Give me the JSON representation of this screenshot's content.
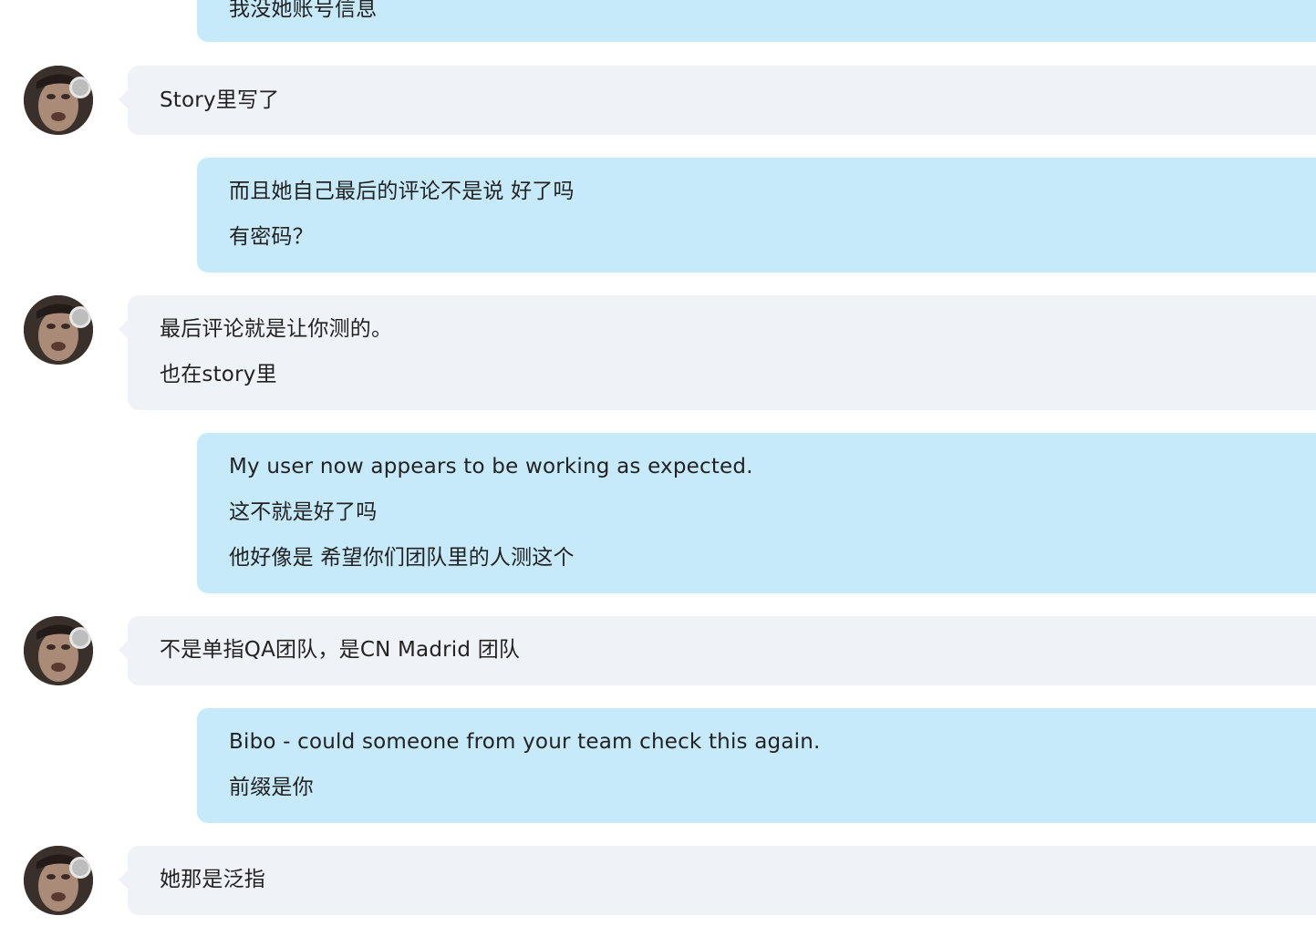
{
  "conversation": {
    "messages": [
      {
        "sender": "me",
        "lines": [
          "我没她账号信息"
        ]
      },
      {
        "sender": "other",
        "lines": [
          "Story里写了"
        ]
      },
      {
        "sender": "me",
        "lines": [
          "而且她自己最后的评论不是说 好了吗",
          "有密码？"
        ]
      },
      {
        "sender": "other",
        "lines": [
          "最后评论就是让你测的。",
          "也在story里"
        ]
      },
      {
        "sender": "me",
        "lines": [
          "My user now appears to be working as expected.",
          "这不就是好了吗",
          "他好像是 希望你们团队里的人测这个"
        ]
      },
      {
        "sender": "other",
        "lines": [
          "不是单指QA团队，是CN Madrid 团队"
        ]
      },
      {
        "sender": "me",
        "lines": [
          "Bibo - could someone from your team check this again.",
          "前缀是你"
        ]
      },
      {
        "sender": "other",
        "lines": [
          "她那是泛指"
        ]
      }
    ]
  },
  "colors": {
    "my_bubble": "#c7eafa",
    "their_bubble": "#eff2f7",
    "text": "#222222",
    "background": "#ffffff"
  },
  "icons": {
    "avatar": "user-avatar-photo"
  }
}
